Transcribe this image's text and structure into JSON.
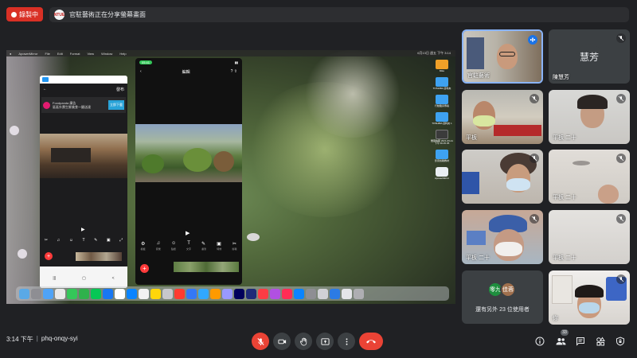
{
  "recording": {
    "label": "錄製中"
  },
  "banner": {
    "avatar_text": "NTUE",
    "text": "官駐藝術正在分享螢幕畫面"
  },
  "shared_screen": {
    "menubar": {
      "items": [
        "ApowerMirror",
        "File",
        "Edit",
        "Format",
        "View",
        "Window",
        "Help"
      ],
      "clock": "6月13日 週五 下午 3:14"
    },
    "phone_left": {
      "header_right": "發布",
      "ad": {
        "brand": "Foodpanda",
        "tag": "廣告",
        "desc": "區區外賣生鮮美食一鍵送達",
        "cta": "立即下載"
      },
      "tools": [
        "✂",
        "♫",
        "☺",
        "T",
        "✎",
        "▣",
        "⤢"
      ],
      "nav": [
        "|||",
        "▢",
        "<"
      ]
    },
    "phone_right": {
      "time": "05:41",
      "title": "編輯",
      "tools": [
        "⚙",
        "♫",
        "☺",
        "T",
        "✎",
        "▣",
        "✂"
      ],
      "tool_names": [
        "模板",
        "音樂",
        "貼紙",
        "文字",
        "畫筆",
        "特效",
        "剪輯"
      ]
    },
    "desktop_icons": [
      {
        "label": "Mike",
        "kind": "orange"
      },
      {
        "label": "TOSHIBA 資料夾",
        "kind": "blue"
      },
      {
        "label": "行動載具專案",
        "kind": "blue"
      },
      {
        "label": "TOSHIBA 資料夾 1",
        "kind": "blue"
      },
      {
        "label": "螢幕快照 2021-06-11 下午 06.45.05",
        "kind": "dark"
      },
      {
        "label": "影音剪輯教材",
        "kind": "blue"
      },
      {
        "label": "ApowerMirror",
        "kind": "white"
      }
    ]
  },
  "participants": [
    {
      "name": "官駐藝術",
      "mic": "speaking",
      "kind": "video"
    },
    {
      "name": "陳慧芳",
      "mic": "off",
      "kind": "avatar",
      "avatar_text": "慧芳"
    },
    {
      "name": "平板",
      "mic": "off",
      "kind": "video"
    },
    {
      "name": "平板 二十",
      "mic": "off",
      "kind": "video"
    },
    {
      "name": "",
      "mic": "off",
      "kind": "video"
    },
    {
      "name": "平板 二十",
      "mic": "off",
      "kind": "video"
    },
    {
      "name": "平板 二十",
      "mic": "off",
      "kind": "video"
    },
    {
      "name": "平板 二十",
      "mic": "off",
      "kind": "video"
    },
    {
      "name": "你",
      "mic": "off",
      "kind": "video"
    }
  ],
  "others": {
    "avatar1": "零九",
    "avatar2": "佳蓉",
    "text": "還有另外 23 位使用者"
  },
  "meeting": {
    "time": "3:14 下午",
    "separator": "|",
    "code": "phq-onqy-syi"
  },
  "people_count": "33",
  "colors": {
    "end_call": "#ea4335",
    "recording": "#d93025",
    "speaking": "#1a73e8",
    "accent": "#8ab4f8"
  }
}
